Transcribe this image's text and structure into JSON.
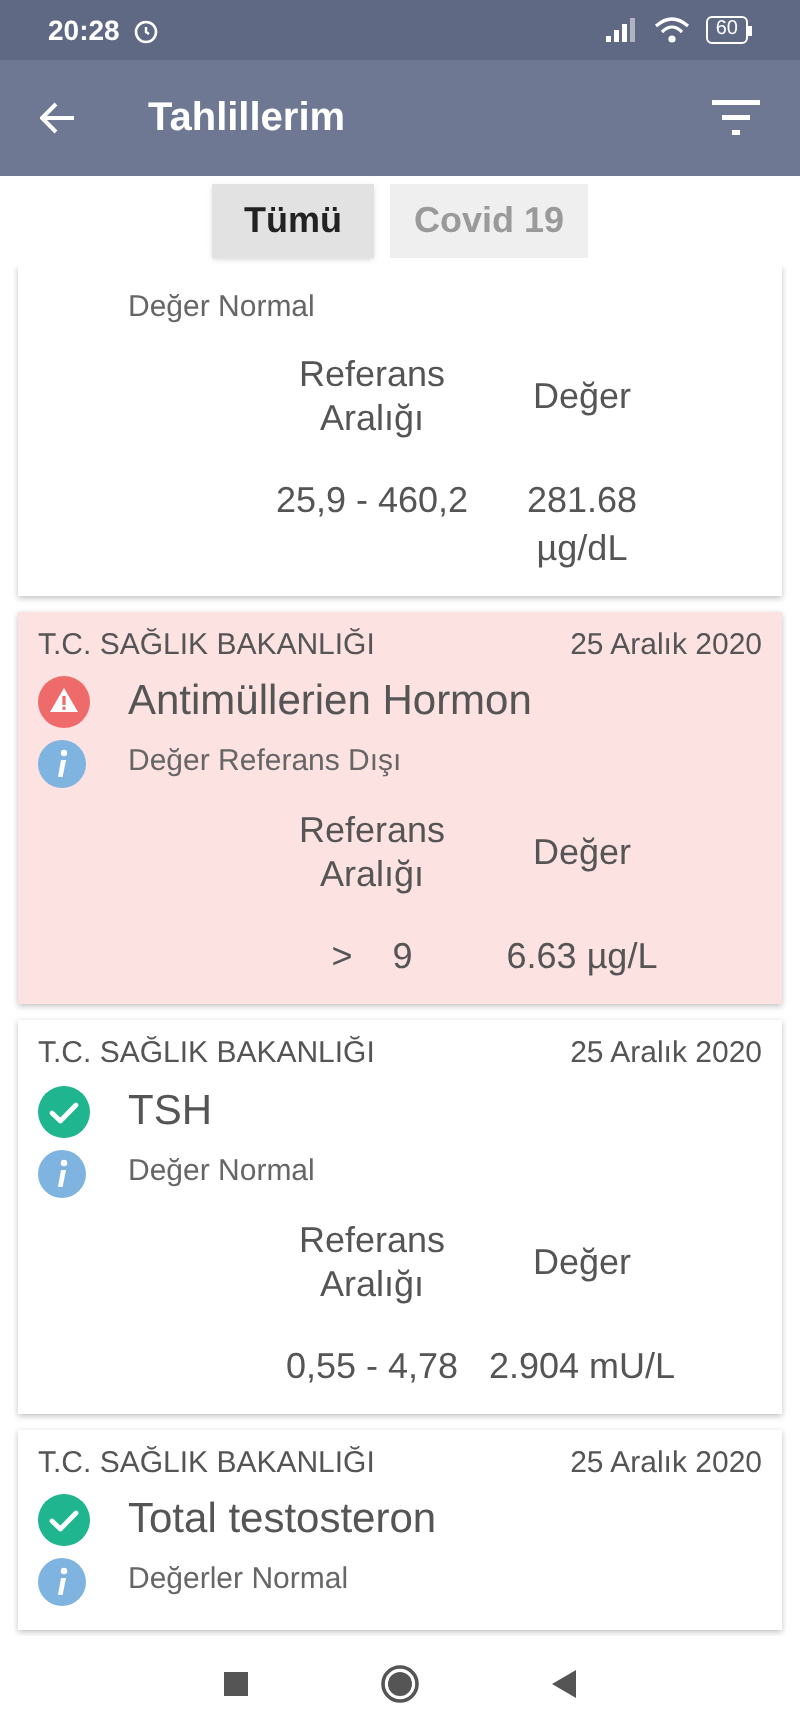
{
  "status_bar": {
    "time": "20:28",
    "battery": "60"
  },
  "app_bar": {
    "title": "Tahlillerim"
  },
  "tabs": [
    {
      "label": "Tümü",
      "selected": true
    },
    {
      "label": "Covid 19",
      "selected": false
    }
  ],
  "results": [
    {
      "out_of_range": false,
      "subtitle": "Değer Normal",
      "ref_header": "Referans Aralığı",
      "value_header": "Değer",
      "reference": "25,9 - 460,2",
      "value": "281.68 µg/dL"
    },
    {
      "out_of_range": true,
      "source": "T.C. SAĞLIK BAKANLIĞI",
      "date": "25 Aralık 2020",
      "title": "Antimüllerien Hormon",
      "subtitle": "Değer Referans Dışı",
      "ref_header": "Referans Aralığı",
      "value_header": "Değer",
      "reference": ">    9",
      "value": "6.63 µg/L"
    },
    {
      "out_of_range": false,
      "source": "T.C. SAĞLIK BAKANLIĞI",
      "date": "25 Aralık 2020",
      "title": "TSH",
      "subtitle": "Değer Normal",
      "ref_header": "Referans Aralığı",
      "value_header": "Değer",
      "reference": "0,55 - 4,78",
      "value": "2.904 mU/L"
    },
    {
      "out_of_range": false,
      "source": "T.C. SAĞLIK BAKANLIĞI",
      "date": "25 Aralık 2020",
      "title": "Total testosteron",
      "subtitle": "Değerler Normal"
    }
  ]
}
